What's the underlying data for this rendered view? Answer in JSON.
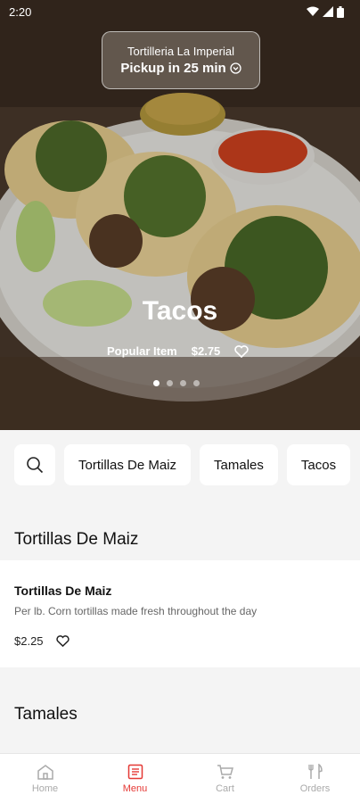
{
  "status_bar": {
    "time": "2:20"
  },
  "hero": {
    "restaurant_name": "Tortilleria La Imperial",
    "pickup_label": "Pickup in 25 min",
    "title": "Tacos",
    "tag": "Popular Item",
    "price": "$2.75",
    "slides": 4,
    "active_slide": 0
  },
  "categories": {
    "chips": [
      "Tortillas De Maiz",
      "Tamales",
      "Tacos"
    ]
  },
  "sections": [
    {
      "title": "Tortillas De Maiz",
      "items": [
        {
          "name": "Tortillas De Maiz",
          "description": "Per lb. Corn tortillas made fresh throughout the day",
          "price": "$2.25"
        }
      ]
    },
    {
      "title": "Tamales"
    }
  ],
  "tabs": [
    {
      "label": "Home",
      "icon": "home-icon",
      "active": false
    },
    {
      "label": "Menu",
      "icon": "menu-icon",
      "active": true
    },
    {
      "label": "Cart",
      "icon": "cart-icon",
      "active": false
    },
    {
      "label": "Orders",
      "icon": "orders-icon",
      "active": false
    }
  ],
  "colors": {
    "accent": "#e53935",
    "inactive": "#aaaaaa"
  }
}
